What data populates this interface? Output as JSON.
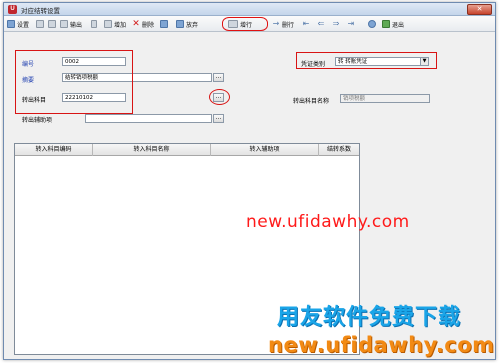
{
  "window": {
    "title": "对应结转设置",
    "close_glyph": "✕"
  },
  "toolbar": {
    "items": [
      {
        "label": "设置",
        "icon": "settings-icon"
      },
      {
        "label": "",
        "icon": "print-icon"
      },
      {
        "label": "",
        "icon": "preview-icon"
      },
      {
        "label": "输出",
        "icon": "export-icon"
      },
      {
        "label": "",
        "icon": "separator"
      },
      {
        "label": "增加",
        "icon": "add-icon"
      },
      {
        "label": "删除",
        "icon": "delete-icon"
      },
      {
        "label": "",
        "icon": "save-icon"
      },
      {
        "label": "放弃",
        "icon": "discard-icon"
      },
      {
        "label": "增行",
        "icon": "add-row-icon"
      },
      {
        "label": "删行",
        "icon": "delete-row-icon"
      },
      {
        "label": "",
        "icon": "first-icon"
      },
      {
        "label": "",
        "icon": "prev-icon"
      },
      {
        "label": "",
        "icon": "next-icon"
      },
      {
        "label": "",
        "icon": "last-icon"
      },
      {
        "label": "",
        "icon": "help-icon"
      },
      {
        "label": "退出",
        "icon": "exit-icon"
      }
    ]
  },
  "form": {
    "code_label": "编号",
    "code_value": "0002",
    "summary_label": "摘要",
    "summary_value": "结转销项税额",
    "out_account_label": "转出科目",
    "out_account_value": "22210102",
    "out_aux_label": "转出辅助项",
    "out_aux_value": "",
    "voucher_type_label": "凭证类别",
    "voucher_type_value": "转  转账凭证",
    "out_account_name_label": "转出科目名称",
    "out_account_name_value": "销项税额",
    "browse_glyph": "...",
    "dropdown_glyph": "▼"
  },
  "grid": {
    "columns": [
      "转入科目编码",
      "转入科目名称",
      "转入辅助项",
      "结转系数"
    ]
  },
  "watermark": {
    "site": "new.ufidawhy.com",
    "cn": "用友软件免费下载",
    "url": "new.ufidawhy.com"
  },
  "colors": {
    "highlight": "#d81414",
    "label_blue": "#1f3fb0",
    "watermark_red": "#ff1a1a",
    "watermark_blue": "#1aa5e8",
    "watermark_orange": "#f28a14"
  }
}
